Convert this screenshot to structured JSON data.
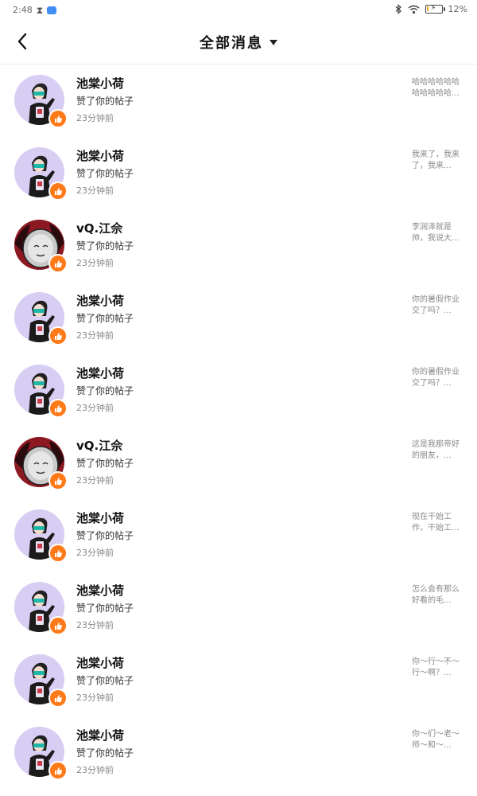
{
  "status_bar": {
    "time": "2:48",
    "battery_percent": "12%",
    "battery_level": 0.12,
    "battery_color": "#e9a317"
  },
  "header": {
    "back_icon": "chevron-left-icon",
    "title": "全部消息",
    "dropdown_icon": "caret-down-icon"
  },
  "accent_color": "#ff7a18",
  "notifications": [
    {
      "name": "池棠小荷",
      "action": "赞了你的帖子",
      "time": "23分钟前",
      "preview": "哈哈哈哈哈哈哈哈哈哈哈...",
      "avatar": "purple"
    },
    {
      "name": "池棠小荷",
      "action": "赞了你的帖子",
      "time": "23分钟前",
      "preview": "我来了，我来了，我来...",
      "avatar": "purple"
    },
    {
      "name": "vQ.江佘",
      "action": "赞了你的帖子",
      "time": "23分钟前",
      "preview": "李润泽就是帅，我说大...",
      "avatar": "red"
    },
    {
      "name": "池棠小荷",
      "action": "赞了你的帖子",
      "time": "23分钟前",
      "preview": "你的暑假作业交了吗？...",
      "avatar": "purple"
    },
    {
      "name": "池棠小荷",
      "action": "赞了你的帖子",
      "time": "23分钟前",
      "preview": "你的暑假作业交了吗？...",
      "avatar": "purple"
    },
    {
      "name": "vQ.江佘",
      "action": "赞了你的帖子",
      "time": "23分钟前",
      "preview": "这是我那帝好的朋友，...",
      "avatar": "red"
    },
    {
      "name": "池棠小荷",
      "action": "赞了你的帖子",
      "time": "23分钟前",
      "preview": "现在干始工作，干始工...",
      "avatar": "purple"
    },
    {
      "name": "池棠小荷",
      "action": "赞了你的帖子",
      "time": "23分钟前",
      "preview": "怎么会有那么好看的毛...",
      "avatar": "purple"
    },
    {
      "name": "池棠小荷",
      "action": "赞了你的帖子",
      "time": "23分钟前",
      "preview": "你～行～不～行～啊？...",
      "avatar": "purple"
    },
    {
      "name": "池棠小荷",
      "action": "赞了你的帖子",
      "time": "23分钟前",
      "preview": "你～们～老～师～和～...",
      "avatar": "purple"
    }
  ]
}
